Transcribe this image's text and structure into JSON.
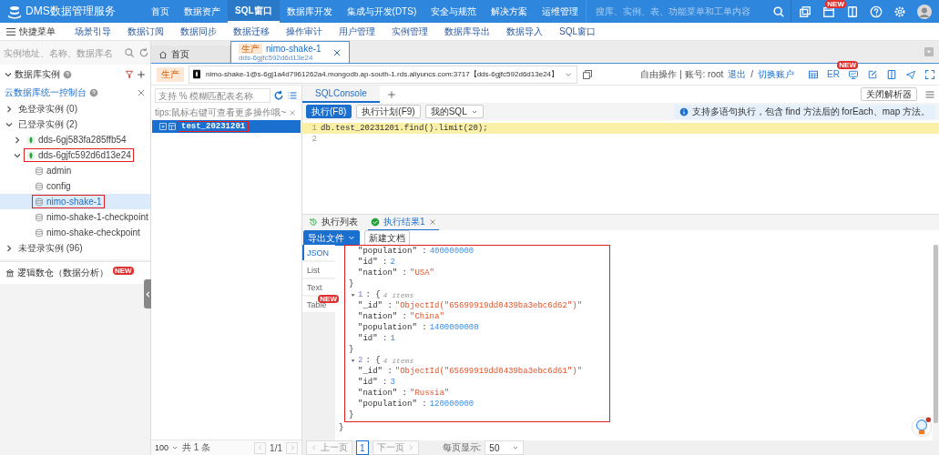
{
  "top_bar": {
    "brand": "DMS数据管理服务",
    "nav": [
      {
        "label": "首页",
        "selected": false
      },
      {
        "label": "数据资产",
        "selected": false
      },
      {
        "label": "SQL窗口",
        "selected": true
      },
      {
        "label": "数据库开发",
        "selected": false
      },
      {
        "label": "集成与开发(DTS)",
        "selected": false
      },
      {
        "label": "安全与规范",
        "selected": false
      },
      {
        "label": "解决方案",
        "selected": false
      },
      {
        "label": "运维管理",
        "selected": false
      }
    ],
    "search": {
      "placeholder": "搜库、实例、表、功能菜单和工单内容"
    },
    "icons": [
      {
        "kind": "copy"
      },
      {
        "kind": "calendar",
        "badge": "NEW"
      },
      {
        "kind": "book"
      },
      {
        "kind": "help"
      },
      {
        "kind": "settings"
      },
      {
        "kind": "avatar"
      }
    ]
  },
  "quick_bar": {
    "menu_label": "快捷菜单",
    "links": [
      "场景引导",
      "数据订阅",
      "数据同步",
      "数据迁移",
      "操作审计",
      "用户管理",
      "实例管理",
      "数据库导出",
      "数据导入",
      "SQL窗口"
    ]
  },
  "sidebar": {
    "search": {
      "placeholder": "实例地址、名称、数据库名"
    },
    "title": "数据库实例",
    "console_link": "云数据库统一控制台",
    "tree": [
      {
        "label": "免登录实例 (0)",
        "kind": "group",
        "expanded": false,
        "selected": false,
        "highlighted": false
      },
      {
        "label": "已登录实例 (2)",
        "kind": "group",
        "expanded": true,
        "selected": false,
        "highlighted": false,
        "children": [
          {
            "label": "dds-6gj583fa285ffb54",
            "kind": "instance",
            "expanded": false,
            "selected": false,
            "highlighted": false
          },
          {
            "label": "dds-6gjfc592d6d13e24",
            "kind": "instance",
            "expanded": true,
            "selected": false,
            "highlighted": true,
            "children": [
              {
                "label": "admin",
                "kind": "database",
                "selected": false,
                "highlighted": false
              },
              {
                "label": "config",
                "kind": "database",
                "selected": false,
                "highlighted": false
              },
              {
                "label": "nimo-shake-1",
                "kind": "database",
                "selected": true,
                "highlighted": true
              },
              {
                "label": "nimo-shake-1-checkpoint",
                "kind": "database",
                "selected": false,
                "highlighted": false
              },
              {
                "label": "nimo-shake-checkpoint",
                "kind": "database",
                "selected": false,
                "highlighted": false
              }
            ]
          }
        ]
      },
      {
        "label": "未登录实例 (96)",
        "kind": "group",
        "expanded": false,
        "selected": false,
        "highlighted": false
      }
    ],
    "footer": {
      "label": "逻辑数仓（数据分析）",
      "badge": "NEW"
    }
  },
  "tabs": [
    {
      "kind": "home",
      "label": "首页",
      "selected": false
    },
    {
      "kind": "connection",
      "label": "nimo-shake-1",
      "env": "生产",
      "subtitle": "dds-6gjfc592d6d13e24",
      "selected": true
    }
  ],
  "connection_bar": {
    "env": "生产",
    "connection": "nimo-shake-1@s-6gj1a4d7961262a4.mongodb.ap-south-1.rds.aliyuncs.com:3717【dds-6gjfc592d6d13e24】",
    "mode": "自由操作 | 账号: root",
    "logout": "退出",
    "separator": "/",
    "switch": "切换账户",
    "tools": [
      {
        "kind": "table"
      },
      {
        "kind": "er",
        "label": "ER",
        "badge": "NEW"
      },
      {
        "kind": "monitor"
      },
      {
        "kind": "edit"
      },
      {
        "kind": "book"
      },
      {
        "kind": "send"
      },
      {
        "kind": "fullscreen"
      }
    ]
  },
  "table_panel": {
    "search": {
      "placeholder": "支持 % 模糊匹配表名称"
    },
    "tip": "tips:鼠标右键可查看更多操作哦~",
    "tables": [
      {
        "label": "test_20231201",
        "selected": true,
        "highlighted": true
      }
    ],
    "pager": {
      "page_size": "100",
      "total": "共 1 条",
      "page": "1/1"
    }
  },
  "editor": {
    "tabs": [
      {
        "label": "SQLConsole",
        "selected": true
      }
    ],
    "close_parser": "关闭解析器",
    "toolbar": [
      {
        "label": "执行(F8)",
        "kind": "primary"
      },
      {
        "label": "执行计划(F9)",
        "kind": "plain"
      },
      {
        "label": "我的SQL",
        "kind": "dropdown"
      }
    ],
    "info": "支持多语句执行，包含 find 方法后的 forEach、map 方法。",
    "lines": [
      {
        "number": "1",
        "text": "db.test_20231201.find().limit(20);",
        "highlighted": true
      },
      {
        "number": "2",
        "highlighted": false
      }
    ]
  },
  "result": {
    "tabs": [
      {
        "kind": "history",
        "label": "执行列表",
        "selected": false
      },
      {
        "kind": "success",
        "label": "执行结果1",
        "selected": true,
        "closable": true
      }
    ],
    "export": "导出文件",
    "new_doc": "新建文档",
    "views": [
      {
        "label": "JSON",
        "selected": true
      },
      {
        "label": "List",
        "selected": false
      },
      {
        "label": "Text",
        "selected": false
      },
      {
        "label": "Table",
        "selected": false,
        "badge": "NEW"
      }
    ],
    "highlighted": true,
    "lines": [
      {
        "kind": "field",
        "key": "\"population\" :",
        "value": "400000000",
        "is_string": false
      },
      {
        "kind": "field",
        "key": "\"id\" :",
        "value": "2",
        "is_string": false
      },
      {
        "kind": "field",
        "key": "\"nation\" :",
        "value": "\"USA\"",
        "is_string": true
      },
      {
        "kind": "close",
        "text": "}"
      },
      {
        "kind": "open",
        "index": "1",
        "punct": ": {",
        "comment": "4 items"
      },
      {
        "kind": "field",
        "key": "\"_id\" :",
        "value": "\"ObjectId(\"65699919dd0439ba3ebc6d62\")\"",
        "is_string": true
      },
      {
        "kind": "field",
        "key": "\"nation\" :",
        "value": "\"China\"",
        "is_string": true
      },
      {
        "kind": "field",
        "key": "\"population\" :",
        "value": "1400000000",
        "is_string": false
      },
      {
        "kind": "field",
        "key": "\"id\" :",
        "value": "1",
        "is_string": false
      },
      {
        "kind": "close",
        "text": "}"
      },
      {
        "kind": "open",
        "index": "2",
        "punct": ": {",
        "comment": "4 items"
      },
      {
        "kind": "field",
        "key": "\"_id\" :",
        "value": "\"ObjectId(\"65699919dd0439ba3ebc6d61\")\"",
        "is_string": true
      },
      {
        "kind": "field",
        "key": "\"id\" :",
        "value": "3",
        "is_string": false
      },
      {
        "kind": "field",
        "key": "\"nation\" :",
        "value": "\"Russia\"",
        "is_string": true
      },
      {
        "kind": "field",
        "key": "\"population\" :",
        "value": "120000000",
        "is_string": false
      },
      {
        "kind": "close",
        "text": "}"
      }
    ],
    "root_close": "}",
    "pager": {
      "prev": "上一页",
      "page": "1",
      "next": "下一页",
      "per_page_label": "每页显示:",
      "per_page": "50"
    }
  }
}
